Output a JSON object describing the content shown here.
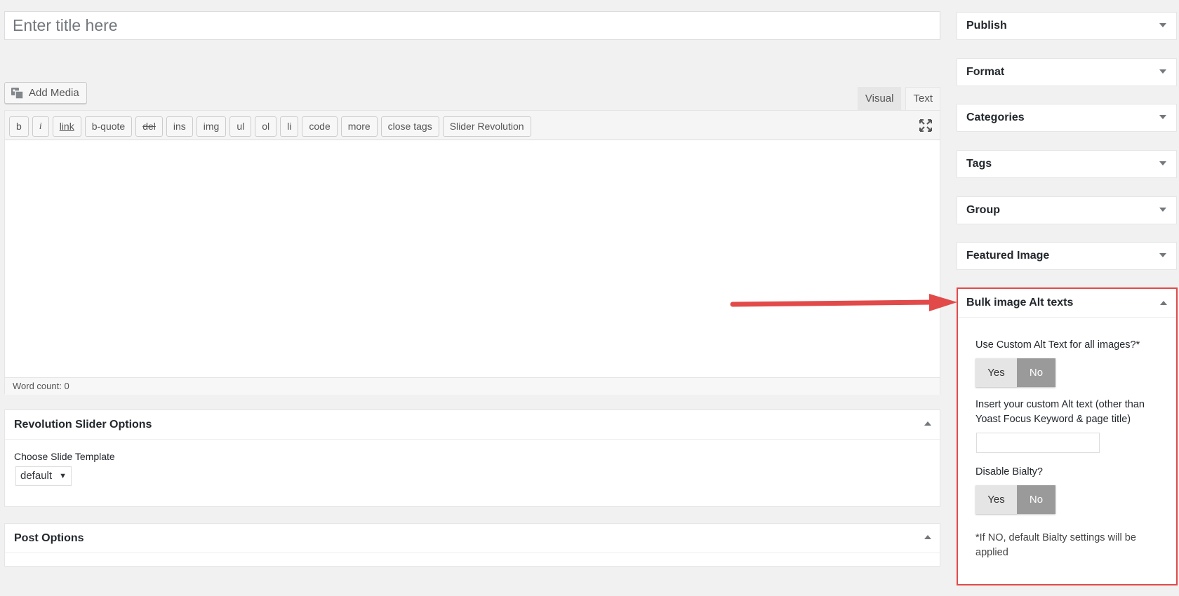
{
  "title": {
    "placeholder": "Enter title here"
  },
  "toolbar": {
    "add_media_label": "Add Media",
    "tabs": [
      {
        "label": "Visual"
      },
      {
        "label": "Text"
      }
    ],
    "buttons": [
      {
        "label": "b"
      },
      {
        "label": "i"
      },
      {
        "label": "link"
      },
      {
        "label": "b-quote"
      },
      {
        "label": "del"
      },
      {
        "label": "ins"
      },
      {
        "label": "img"
      },
      {
        "label": "ul"
      },
      {
        "label": "ol"
      },
      {
        "label": "li"
      },
      {
        "label": "code"
      },
      {
        "label": "more"
      },
      {
        "label": "close tags"
      },
      {
        "label": "Slider Revolution"
      }
    ],
    "word_count": "Word count: 0"
  },
  "revolution": {
    "title": "Revolution Slider Options",
    "label": "Choose Slide Template",
    "selected": "default"
  },
  "post_options": {
    "title": "Post Options"
  },
  "sidebar": {
    "boxes": [
      {
        "label": "Publish"
      },
      {
        "label": "Format"
      },
      {
        "label": "Categories"
      },
      {
        "label": "Tags"
      },
      {
        "label": "Group"
      },
      {
        "label": "Featured Image"
      }
    ]
  },
  "bulk_alt": {
    "title": "Bulk image Alt texts",
    "q1": "Use Custom Alt Text for all images?*",
    "q2": "Insert your custom Alt text (other than Yoast Focus Keyword & page title)",
    "q3": "Disable Bialty?",
    "yes_label": "Yes",
    "no_label": "No",
    "note": "*If NO, default Bialty settings will be applied"
  },
  "colors": {
    "highlight": "#e24a4a",
    "toggle_active": "#9a9a9a"
  }
}
